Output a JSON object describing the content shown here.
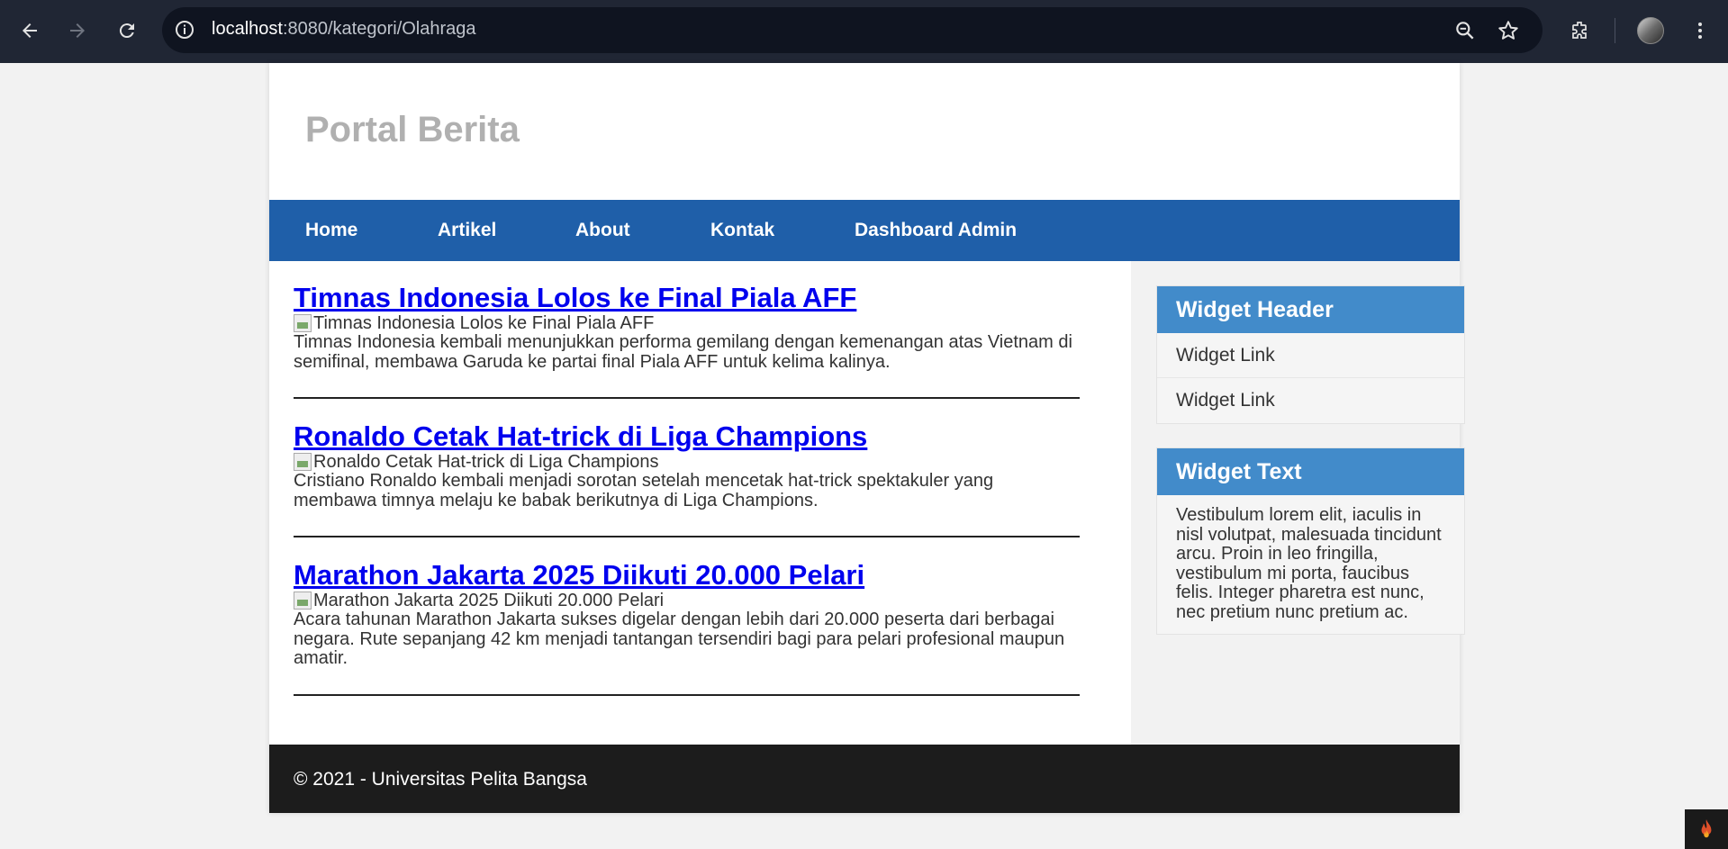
{
  "browser": {
    "url_host": "localhost",
    "url_rest": ":8080/kategori/Olahraga",
    "icons": [
      "back-icon",
      "forward-icon",
      "reload-icon",
      "site-info-icon",
      "zoom-icon",
      "bookmark-star-icon",
      "extensions-icon",
      "profile-avatar",
      "menu-kebab-icon"
    ]
  },
  "site": {
    "title": "Portal Berita",
    "nav": [
      "Home",
      "Artikel",
      "About",
      "Kontak",
      "Dashboard Admin"
    ]
  },
  "articles": [
    {
      "title": "Timnas Indonesia Lolos ke Final Piala AFF",
      "image_alt": "Timnas Indonesia Lolos ke Final Piala AFF",
      "body": "Timnas Indonesia kembali menunjukkan performa gemilang dengan kemenangan atas Vietnam di semifinal, membawa Garuda ke partai final Piala AFF untuk kelima kalinya."
    },
    {
      "title": "Ronaldo Cetak Hat-trick di Liga Champions",
      "image_alt": "Ronaldo Cetak Hat-trick di Liga Champions",
      "body": "Cristiano Ronaldo kembali menjadi sorotan setelah mencetak hat-trick spektakuler yang membawa timnya melaju ke babak berikutnya di Liga Champions."
    },
    {
      "title": "Marathon Jakarta 2025 Diikuti 20.000 Pelari",
      "image_alt": "Marathon Jakarta 2025 Diikuti 20.000 Pelari",
      "body": "Acara tahunan Marathon Jakarta sukses digelar dengan lebih dari 20.000 peserta dari berbagai negara. Rute sepanjang 42 km menjadi tantangan tersendiri bagi para pelari profesional maupun amatir."
    }
  ],
  "sidebar": {
    "widget1": {
      "header": "Widget Header",
      "links": [
        "Widget Link",
        "Widget Link"
      ]
    },
    "widget2": {
      "header": "Widget Text",
      "text": "Vestibulum lorem elit, iaculis in nisl volutpat, malesuada tincidunt arcu. Proin in leo fringilla, vestibulum mi porta, faucibus felis. Integer pharetra est nunc, nec pretium nunc pretium ac."
    }
  },
  "footer": {
    "text": "© 2021 - Universitas Pelita Bangsa"
  },
  "colors": {
    "nav_bg": "#1f5fa9",
    "widget_head_bg": "#428bca",
    "footer_bg": "#1c1c1c",
    "link": "#0000ee",
    "title_gray": "#b0b0b0"
  }
}
